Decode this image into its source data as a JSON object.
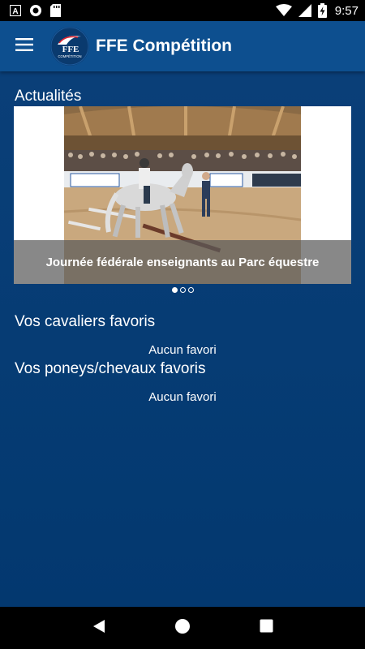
{
  "status_bar": {
    "time": "9:57",
    "icons": [
      "a-notification-icon",
      "circle-notification-icon",
      "sd-card-icon",
      "wifi-icon",
      "signal-icon",
      "battery-charging-icon"
    ]
  },
  "app_bar": {
    "title": "FFE Compétition",
    "logo_text": "FFE",
    "logo_subtext": "COMPÉTITION"
  },
  "news": {
    "heading": "Actualités",
    "slides": [
      {
        "caption": "Journée fédérale enseignants au Parc équestre"
      }
    ],
    "dot_count": 3,
    "active_index": 0
  },
  "favorite_riders": {
    "heading": "Vos cavaliers favoris",
    "empty_text": "Aucun favori"
  },
  "favorite_horses": {
    "heading": "Vos poneys/chevaux favoris",
    "empty_text": "Aucun favori"
  },
  "colors": {
    "app_bar": "#0d4f8f",
    "background": "#063c74",
    "caption_band": "#5a5a5a"
  },
  "nav_bar": {
    "icons": [
      "back-icon",
      "home-icon",
      "recents-icon"
    ]
  }
}
